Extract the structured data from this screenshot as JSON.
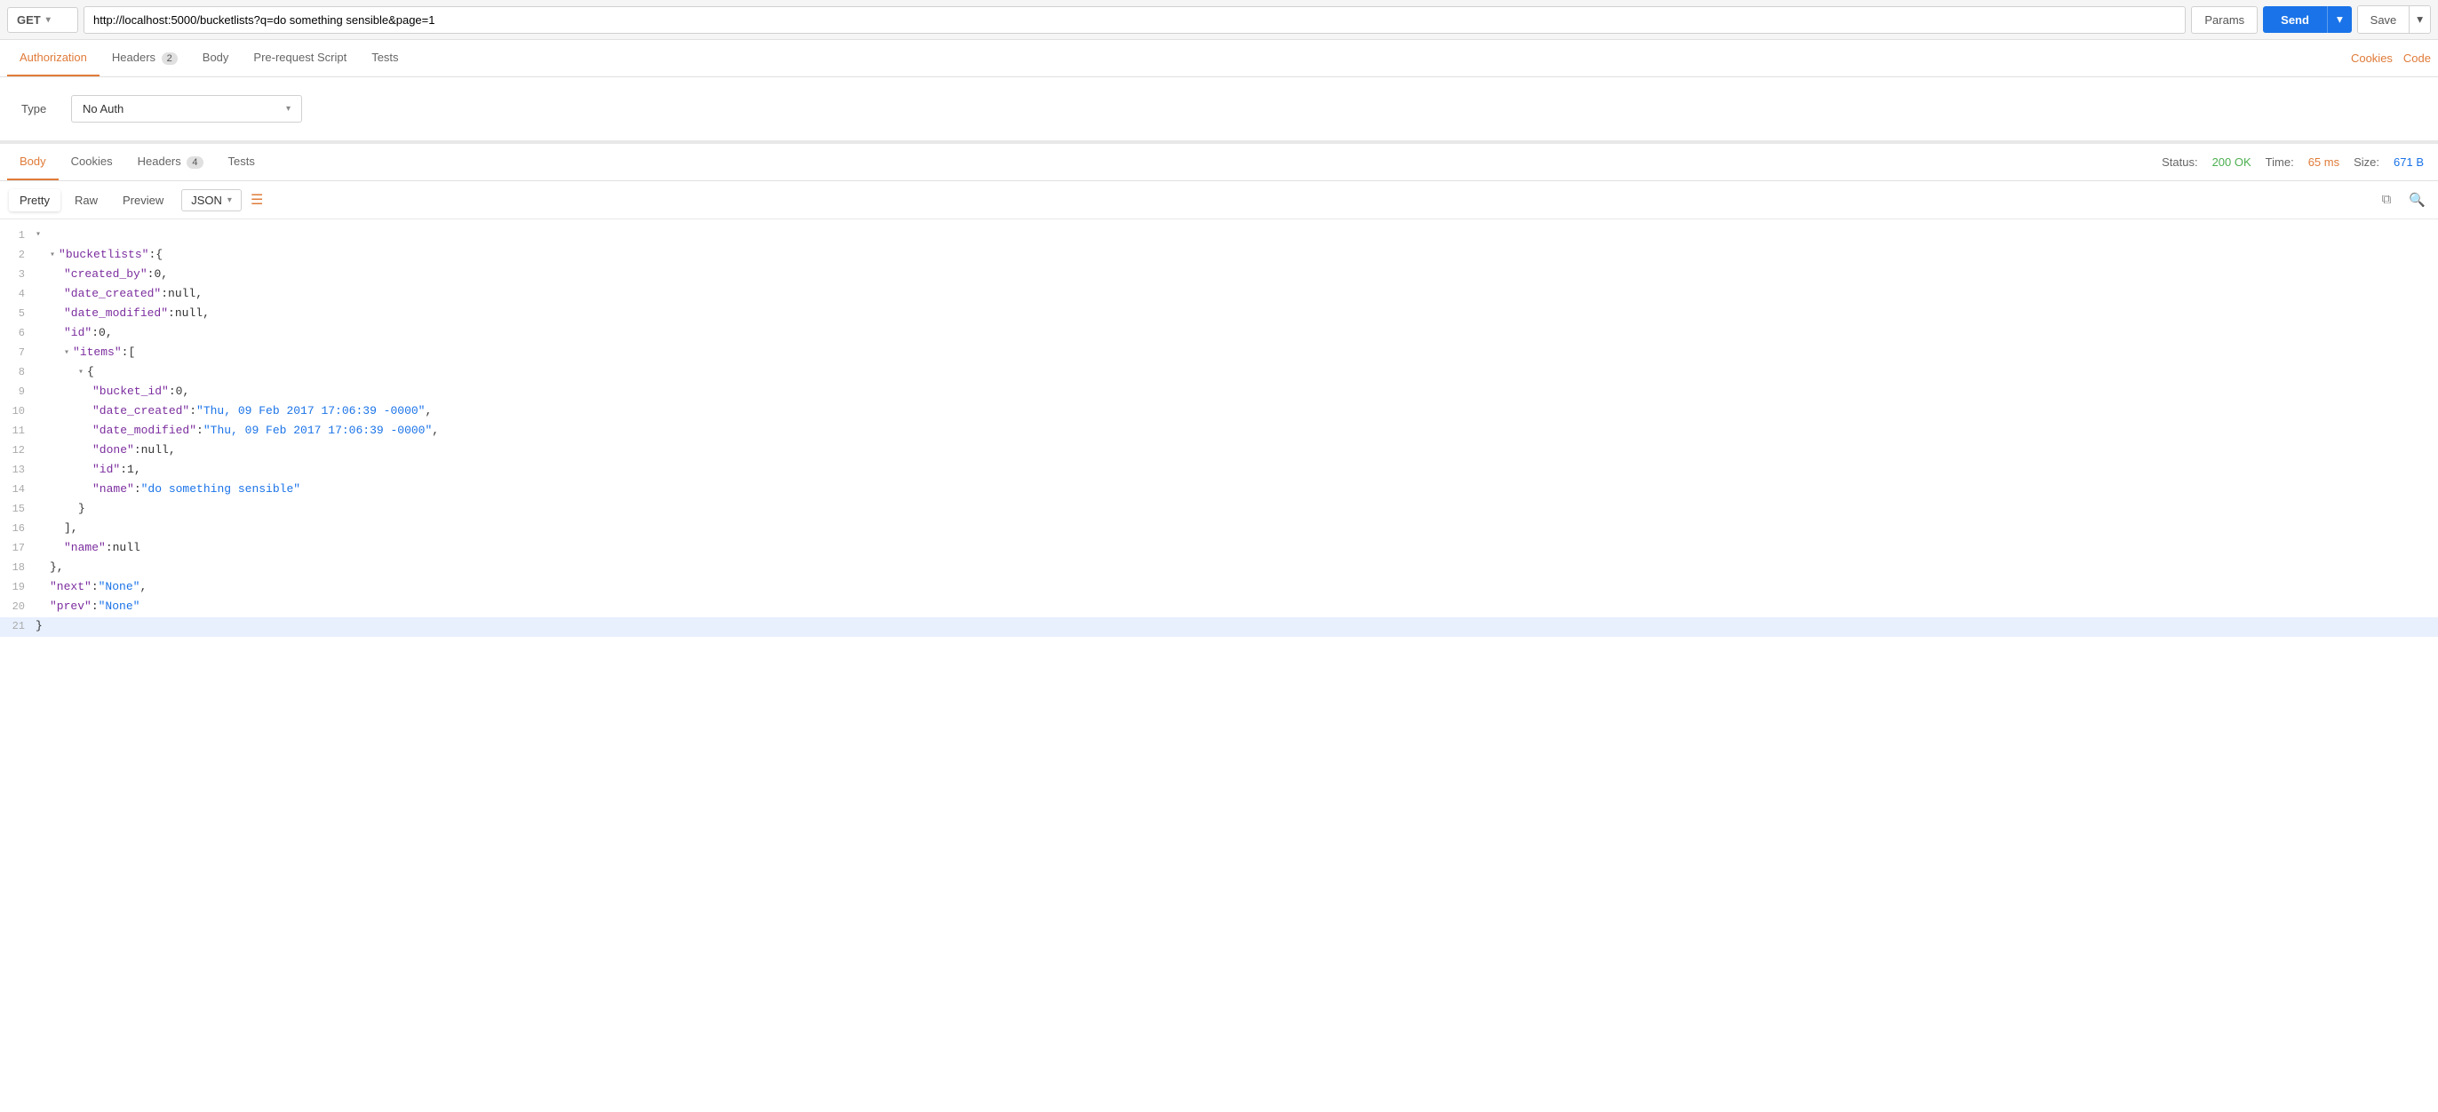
{
  "topbar": {
    "method": "GET",
    "url": "http://localhost:5000/bucketlists?q=do something sensible&page=1",
    "params_label": "Params",
    "send_label": "Send",
    "save_label": "Save"
  },
  "request_tabs": [
    {
      "id": "authorization",
      "label": "Authorization",
      "active": true,
      "badge": null
    },
    {
      "id": "headers",
      "label": "Headers",
      "active": false,
      "badge": "2"
    },
    {
      "id": "body",
      "label": "Body",
      "active": false,
      "badge": null
    },
    {
      "id": "prerequest",
      "label": "Pre-request Script",
      "active": false,
      "badge": null
    },
    {
      "id": "tests",
      "label": "Tests",
      "active": false,
      "badge": null
    }
  ],
  "tab_right": {
    "cookies": "Cookies",
    "code": "Code"
  },
  "auth": {
    "type_label": "Type",
    "type_value": "No Auth"
  },
  "response": {
    "tabs": [
      {
        "id": "body",
        "label": "Body",
        "active": true,
        "badge": null
      },
      {
        "id": "cookies",
        "label": "Cookies",
        "active": false,
        "badge": null
      },
      {
        "id": "headers",
        "label": "Headers",
        "active": false,
        "badge": "4"
      },
      {
        "id": "tests",
        "label": "Tests",
        "active": false,
        "badge": null
      }
    ],
    "status_label": "Status:",
    "status_value": "200 OK",
    "time_label": "Time:",
    "time_value": "65 ms",
    "size_label": "Size:",
    "size_value": "671 B"
  },
  "format_tabs": {
    "pretty": "Pretty",
    "raw": "Raw",
    "preview": "Preview",
    "json_format": "JSON"
  },
  "json_lines": [
    {
      "num": 1,
      "fold": true,
      "indent": 0,
      "content": "{"
    },
    {
      "num": 2,
      "fold": true,
      "indent": 1,
      "key": "bucketlists",
      "colon": ": ",
      "value": "{",
      "type": "object-open"
    },
    {
      "num": 3,
      "fold": false,
      "indent": 2,
      "key": "created_by",
      "colon": ": ",
      "value": "0",
      "type": "number",
      "comma": ","
    },
    {
      "num": 4,
      "fold": false,
      "indent": 2,
      "key": "date_created",
      "colon": ": ",
      "value": "null",
      "type": "null",
      "comma": ","
    },
    {
      "num": 5,
      "fold": false,
      "indent": 2,
      "key": "date_modified",
      "colon": ": ",
      "value": "null",
      "type": "null",
      "comma": ","
    },
    {
      "num": 6,
      "fold": false,
      "indent": 2,
      "key": "id",
      "colon": ": ",
      "value": "0",
      "type": "number",
      "comma": ","
    },
    {
      "num": 7,
      "fold": true,
      "indent": 2,
      "key": "items",
      "colon": ": ",
      "value": "[",
      "type": "array-open"
    },
    {
      "num": 8,
      "fold": true,
      "indent": 3,
      "value": "{",
      "type": "object-open"
    },
    {
      "num": 9,
      "fold": false,
      "indent": 4,
      "key": "bucket_id",
      "colon": ": ",
      "value": "0",
      "type": "number",
      "comma": ","
    },
    {
      "num": 10,
      "fold": false,
      "indent": 4,
      "key": "date_created",
      "colon": ": ",
      "value": "\"Thu, 09 Feb 2017 17:06:39 -0000\"",
      "type": "string",
      "comma": ","
    },
    {
      "num": 11,
      "fold": false,
      "indent": 4,
      "key": "date_modified",
      "colon": ": ",
      "value": "\"Thu, 09 Feb 2017 17:06:39 -0000\"",
      "type": "string",
      "comma": ","
    },
    {
      "num": 12,
      "fold": false,
      "indent": 4,
      "key": "done",
      "colon": ": ",
      "value": "null",
      "type": "null",
      "comma": ","
    },
    {
      "num": 13,
      "fold": false,
      "indent": 4,
      "key": "id",
      "colon": ": ",
      "value": "1",
      "type": "number",
      "comma": ","
    },
    {
      "num": 14,
      "fold": false,
      "indent": 4,
      "key": "name",
      "colon": ": ",
      "value": "\"do something sensible\"",
      "type": "string"
    },
    {
      "num": 15,
      "fold": false,
      "indent": 3,
      "value": "}",
      "type": "object-close"
    },
    {
      "num": 16,
      "fold": false,
      "indent": 2,
      "value": "],",
      "type": "array-close"
    },
    {
      "num": 17,
      "fold": false,
      "indent": 2,
      "key": "name",
      "colon": ": ",
      "value": "null",
      "type": "null"
    },
    {
      "num": 18,
      "fold": false,
      "indent": 1,
      "value": "},",
      "type": "object-close"
    },
    {
      "num": 19,
      "fold": false,
      "indent": 1,
      "key": "next",
      "colon": ": ",
      "value": "\"None\"",
      "type": "string",
      "comma": ","
    },
    {
      "num": 20,
      "fold": false,
      "indent": 1,
      "key": "prev",
      "colon": ": ",
      "value": "\"None\"",
      "type": "string"
    },
    {
      "num": 21,
      "fold": false,
      "indent": 0,
      "value": "}",
      "type": "object-close",
      "last": true
    }
  ]
}
